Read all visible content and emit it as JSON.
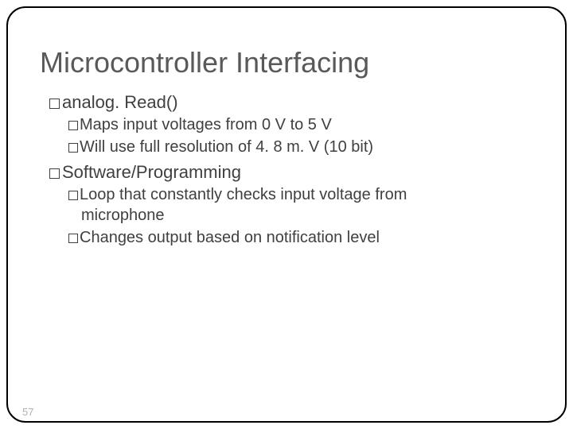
{
  "title": "Microcontroller Interfacing",
  "bullets": {
    "b1": "analog. Read()",
    "b1_1": "Maps input voltages from 0 V to 5 V",
    "b1_2": "Will use full resolution of 4. 8 m. V (10 bit)",
    "b2": "Software/Programming",
    "b2_1": "Loop that constantly checks input voltage from",
    "b2_1_cont": "microphone",
    "b2_2": "Changes output based on notification level"
  },
  "slideNumber": "57"
}
